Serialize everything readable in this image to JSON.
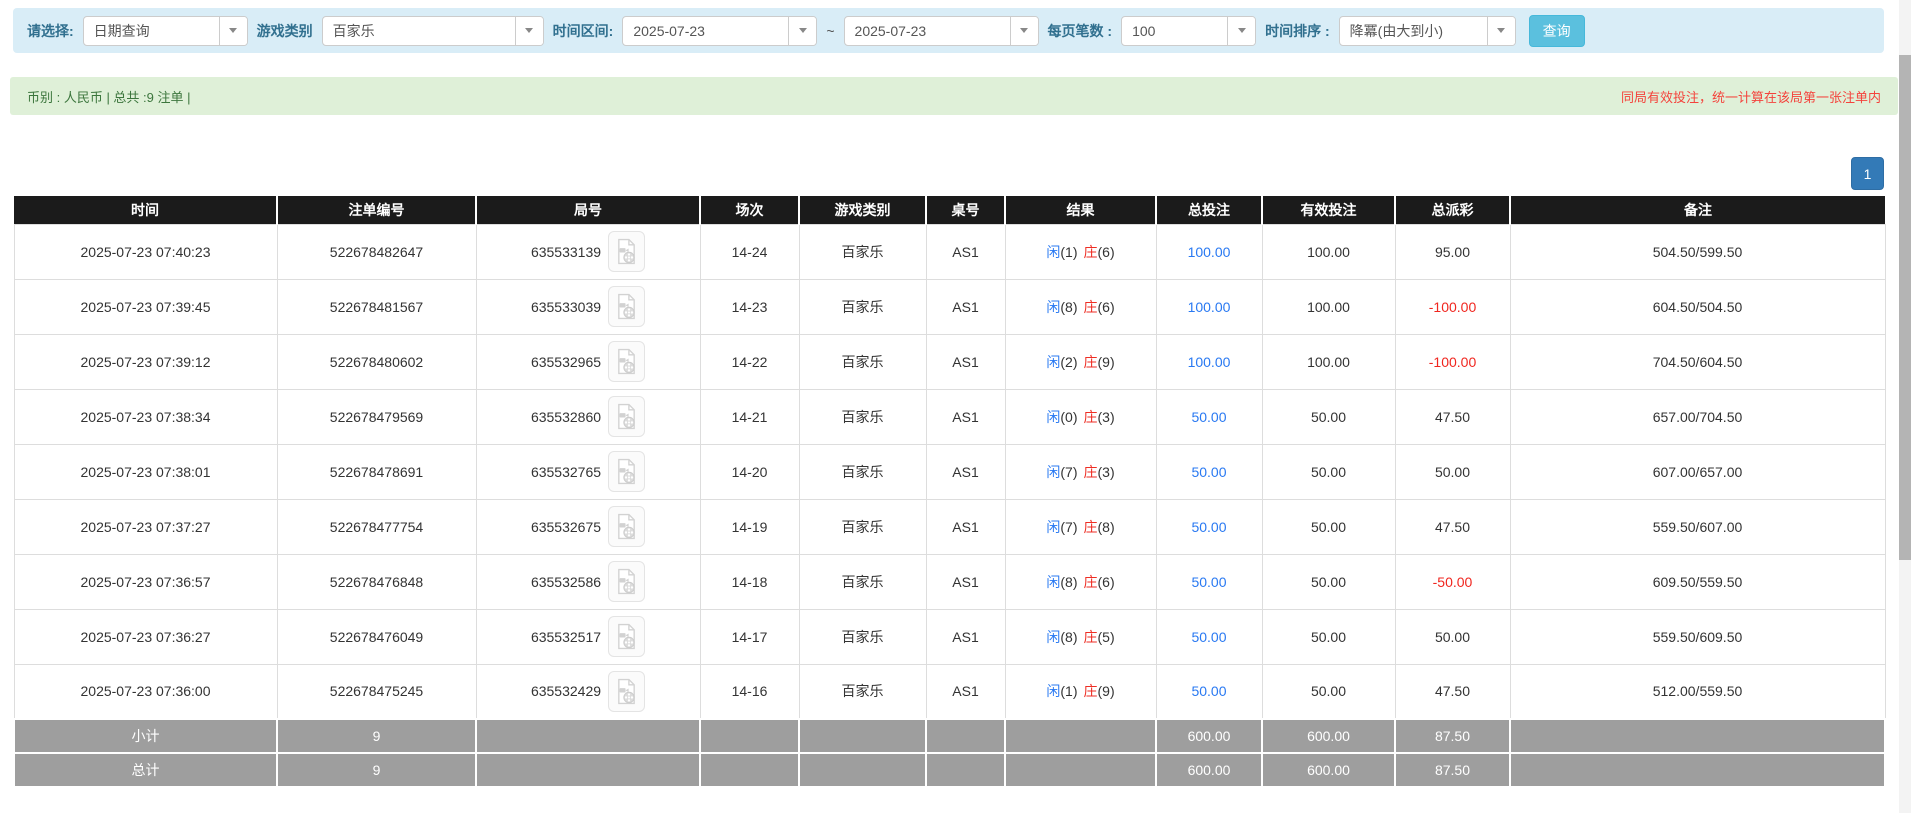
{
  "filter_bar": {
    "select_label": "请选择:",
    "query_type": "日期查询",
    "game_category_label": "游戏类别",
    "game_category": "百家乐",
    "time_range_label": "时间区间:",
    "date_from": "2025-07-23",
    "tilde": "~",
    "date_to": "2025-07-23",
    "page_size_label": "每页笔数 :",
    "page_size": "100",
    "sort_label": "时间排序 :",
    "sort_order": "降冪(由大到小)",
    "search_button": "查询"
  },
  "summary_bar": {
    "left_text": "币别 : 人民币 | 总共 :9 注单 |",
    "right_notice": "同局有效投注，统一计算在该局第一张注单内"
  },
  "pagination": {
    "page": "1"
  },
  "colors": {
    "link_blue": "#2979f2",
    "banker_red": "#ee2e24",
    "payout_positive": "#333333",
    "payout_negative": "#f0261f"
  },
  "table": {
    "headers": {
      "time": "时间",
      "bet_id": "注单编号",
      "round_id": "局号",
      "session": "场次",
      "game_type": "游戏类别",
      "table_no": "桌号",
      "result": "结果",
      "total_bet": "总投注",
      "valid_bet": "有效投注",
      "payout": "总派彩",
      "remark": "备注"
    },
    "rows": [
      {
        "time": "2025-07-23 07:40:23",
        "bet_id": "522678482647",
        "round_id": "635533139",
        "session": "14-24",
        "game_type": "百家乐",
        "table_no": "AS1",
        "result_player_label": "闲",
        "result_player_value": "(1)",
        "result_banker_label": "庄",
        "result_banker_value": "(6)",
        "total_bet": "100.00",
        "valid_bet": "100.00",
        "payout": "95.00",
        "payout_color": "#333333",
        "remark": "504.50/599.50"
      },
      {
        "time": "2025-07-23 07:39:45",
        "bet_id": "522678481567",
        "round_id": "635533039",
        "session": "14-23",
        "game_type": "百家乐",
        "table_no": "AS1",
        "result_player_label": "闲",
        "result_player_value": "(8)",
        "result_banker_label": "庄",
        "result_banker_value": "(6)",
        "total_bet": "100.00",
        "valid_bet": "100.00",
        "payout": "-100.00",
        "payout_color": "#f0261f",
        "remark": "604.50/504.50"
      },
      {
        "time": "2025-07-23 07:39:12",
        "bet_id": "522678480602",
        "round_id": "635532965",
        "session": "14-22",
        "game_type": "百家乐",
        "table_no": "AS1",
        "result_player_label": "闲",
        "result_player_value": "(2)",
        "result_banker_label": "庄",
        "result_banker_value": "(9)",
        "total_bet": "100.00",
        "valid_bet": "100.00",
        "payout": "-100.00",
        "payout_color": "#f0261f",
        "remark": "704.50/604.50"
      },
      {
        "time": "2025-07-23 07:38:34",
        "bet_id": "522678479569",
        "round_id": "635532860",
        "session": "14-21",
        "game_type": "百家乐",
        "table_no": "AS1",
        "result_player_label": "闲",
        "result_player_value": "(0)",
        "result_banker_label": "庄",
        "result_banker_value": "(3)",
        "total_bet": "50.00",
        "valid_bet": "50.00",
        "payout": "47.50",
        "payout_color": "#333333",
        "remark": "657.00/704.50"
      },
      {
        "time": "2025-07-23 07:38:01",
        "bet_id": "522678478691",
        "round_id": "635532765",
        "session": "14-20",
        "game_type": "百家乐",
        "table_no": "AS1",
        "result_player_label": "闲",
        "result_player_value": "(7)",
        "result_banker_label": "庄",
        "result_banker_value": "(3)",
        "total_bet": "50.00",
        "valid_bet": "50.00",
        "payout": "50.00",
        "payout_color": "#333333",
        "remark": "607.00/657.00"
      },
      {
        "time": "2025-07-23 07:37:27",
        "bet_id": "522678477754",
        "round_id": "635532675",
        "session": "14-19",
        "game_type": "百家乐",
        "table_no": "AS1",
        "result_player_label": "闲",
        "result_player_value": "(7)",
        "result_banker_label": "庄",
        "result_banker_value": "(8)",
        "total_bet": "50.00",
        "valid_bet": "50.00",
        "payout": "47.50",
        "payout_color": "#333333",
        "remark": "559.50/607.00"
      },
      {
        "time": "2025-07-23 07:36:57",
        "bet_id": "522678476848",
        "round_id": "635532586",
        "session": "14-18",
        "game_type": "百家乐",
        "table_no": "AS1",
        "result_player_label": "闲",
        "result_player_value": "(8)",
        "result_banker_label": "庄",
        "result_banker_value": "(6)",
        "total_bet": "50.00",
        "valid_bet": "50.00",
        "payout": "-50.00",
        "payout_color": "#f0261f",
        "remark": "609.50/559.50"
      },
      {
        "time": "2025-07-23 07:36:27",
        "bet_id": "522678476049",
        "round_id": "635532517",
        "session": "14-17",
        "game_type": "百家乐",
        "table_no": "AS1",
        "result_player_label": "闲",
        "result_player_value": "(8)",
        "result_banker_label": "庄",
        "result_banker_value": "(5)",
        "total_bet": "50.00",
        "valid_bet": "50.00",
        "payout": "50.00",
        "payout_color": "#333333",
        "remark": "559.50/609.50"
      },
      {
        "time": "2025-07-23 07:36:00",
        "bet_id": "522678475245",
        "round_id": "635532429",
        "session": "14-16",
        "game_type": "百家乐",
        "table_no": "AS1",
        "result_player_label": "闲",
        "result_player_value": "(1)",
        "result_banker_label": "庄",
        "result_banker_value": "(9)",
        "total_bet": "50.00",
        "valid_bet": "50.00",
        "payout": "47.50",
        "payout_color": "#333333",
        "remark": "512.00/559.50"
      }
    ],
    "subtotal": {
      "label": "小计",
      "count": "9",
      "total_bet": "600.00",
      "valid_bet": "600.00",
      "payout": "87.50"
    },
    "total": {
      "label": "总计",
      "count": "9",
      "total_bet": "600.00",
      "valid_bet": "600.00",
      "payout": "87.50"
    }
  }
}
